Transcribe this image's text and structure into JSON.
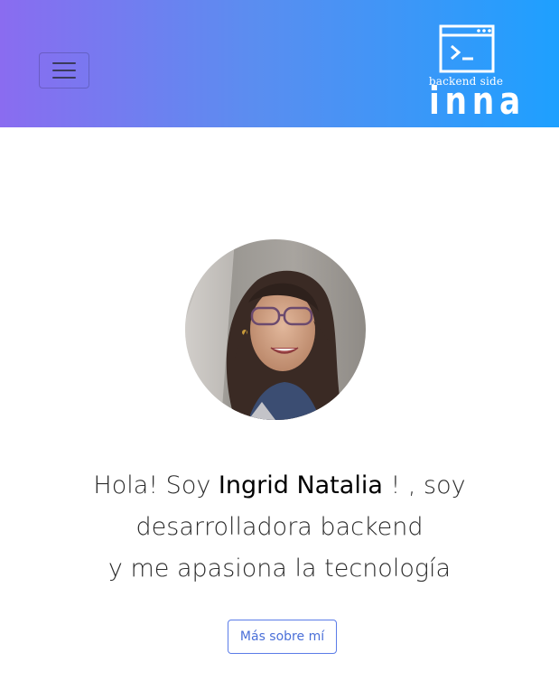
{
  "navbar": {
    "toggler_icon": "hamburger-menu-icon",
    "brand": {
      "logo_icon": "terminal-window-icon",
      "subtitle": "backend side",
      "wordmark": "inna"
    }
  },
  "hero": {
    "intro_prefix": "Hola! Soy ",
    "name": "Ingrid Natalia",
    "intro_suffix": " ! , soy",
    "line2": "desarrolladora backend",
    "line3": "y me apasiona la tecnología",
    "button_label": "Más sobre mí"
  },
  "colors": {
    "gradient_start": "#8a6cf0",
    "gradient_end": "#1ea0ff",
    "button_accent": "#5b7ce8"
  }
}
